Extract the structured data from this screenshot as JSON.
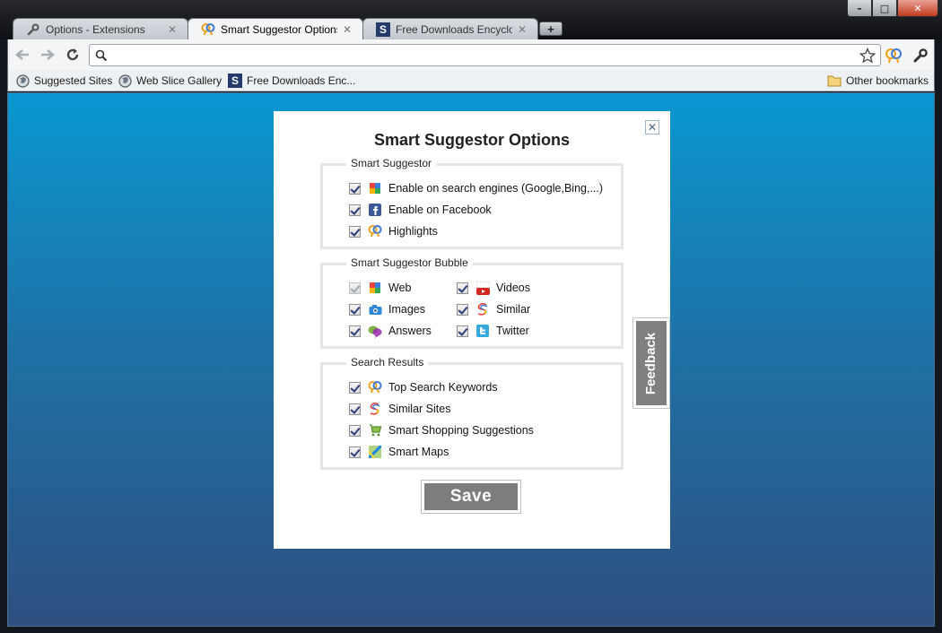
{
  "window": {
    "minimize_glyph": "–",
    "maximize_glyph": "□",
    "close_glyph": "✕"
  },
  "tabs": [
    {
      "title": "Options - Extensions",
      "icon": "wrench-icon",
      "close": "✕",
      "active": false
    },
    {
      "title": "Smart Suggestor Options",
      "icon": "smart-suggestor-icon",
      "close": "✕",
      "active": true
    },
    {
      "title": "Free Downloads Encyclopedia",
      "icon": "softpedia-s-icon",
      "close": "✕",
      "active": false
    }
  ],
  "new_tab_glyph": "+",
  "omnibox": {
    "value": "",
    "placeholder": ""
  },
  "bookmarks": {
    "items": [
      {
        "label": "Suggested Sites",
        "icon": "globe-icon"
      },
      {
        "label": "Web Slice Gallery",
        "icon": "globe-icon"
      },
      {
        "label": "Free Downloads Enc...",
        "icon": "softpedia-s-icon"
      }
    ],
    "other": {
      "label": "Other bookmarks",
      "icon": "folder-icon"
    }
  },
  "dialog": {
    "title": "Smart Suggestor Options",
    "close_glyph": "✕",
    "groups": {
      "suggestor": {
        "legend": "Smart Suggestor",
        "options": [
          {
            "label": "Enable on search engines (Google,Bing,...)",
            "checked": true,
            "icon": "search-engine-icon"
          },
          {
            "label": "Enable on Facebook",
            "checked": true,
            "icon": "facebook-icon"
          },
          {
            "label": "Highlights",
            "checked": true,
            "icon": "highlights-icon"
          }
        ]
      },
      "bubble": {
        "legend": "Smart Suggestor Bubble",
        "options": [
          {
            "label": "Web",
            "checked": true,
            "disabled": true,
            "icon": "web-icon"
          },
          {
            "label": "Videos",
            "checked": true,
            "icon": "youtube-icon"
          },
          {
            "label": "Images",
            "checked": true,
            "icon": "camera-icon"
          },
          {
            "label": "Similar",
            "checked": true,
            "icon": "similar-icon"
          },
          {
            "label": "Answers",
            "checked": true,
            "icon": "answers-icon"
          },
          {
            "label": "Twitter",
            "checked": true,
            "icon": "twitter-icon"
          }
        ]
      },
      "results": {
        "legend": "Search Results",
        "options": [
          {
            "label": "Top Search Keywords",
            "checked": true,
            "icon": "keywords-icon"
          },
          {
            "label": "Similar Sites",
            "checked": true,
            "icon": "similar-icon"
          },
          {
            "label": "Smart Shopping Suggestions",
            "checked": true,
            "icon": "shopping-cart-icon"
          },
          {
            "label": "Smart Maps",
            "checked": true,
            "icon": "map-icon"
          }
        ]
      }
    },
    "save_label": "Save"
  },
  "feedback_label": "Feedback",
  "colors": {
    "content_top": "#0a97d1",
    "content_bottom": "#2e4f80",
    "button_gray": "#7d7d7d"
  }
}
